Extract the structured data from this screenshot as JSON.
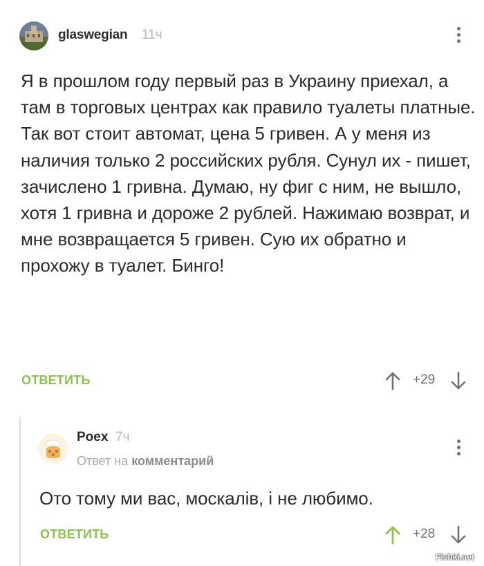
{
  "comment": {
    "author": "glaswegian",
    "time": "11ч",
    "text": "Я в прошлом году первый раз в Украину приехал, а там в торговых центрах как правило туалеты платные. Так вот стоит автомат, цена 5 гривен. А у меня из наличия только 2 российских рубля. Сунул их - пишет, зачислено 1 гривна. Думаю, ну фиг с ним, не вышло, хотя 1 гривна и дороже 2 рублей. Нажимаю возврат, и мне возвращается 5 гривен. Сую их обратно и прохожу в туалет. Бинго!",
    "reply_label": "ОТВЕТИТЬ",
    "score": "+29",
    "upvoted": false
  },
  "reply": {
    "author": "Poex",
    "time": "7ч",
    "answer_prefix": "Ответ на",
    "answer_target": "комментарий",
    "text": "Ото тому ми вас, москалів, і не любимо.",
    "reply_label": "ОТВЕТИТЬ",
    "score": "+28",
    "upvoted": true
  },
  "watermark": "Fishki.net",
  "colors": {
    "accent_green": "#8bc34a",
    "text": "#2b2b2b",
    "muted": "#b9b9b9"
  },
  "icons": [
    "avatar-image",
    "more-vertical-icon",
    "arrow-up-icon",
    "arrow-down-icon"
  ]
}
